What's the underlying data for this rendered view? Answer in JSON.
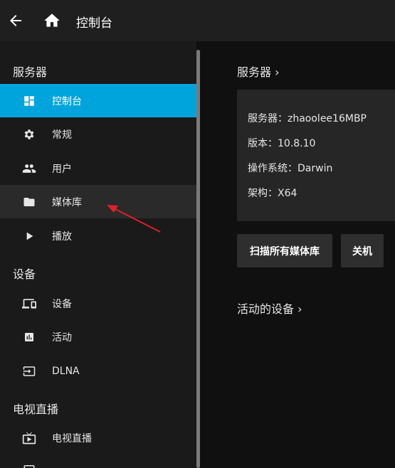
{
  "header": {
    "title": "控制台",
    "back_icon": "arrow-left-icon",
    "home_icon": "home-icon"
  },
  "sidebar": {
    "sections": [
      {
        "title": "服务器"
      },
      {
        "title": "设备"
      },
      {
        "title": "电视直播"
      }
    ],
    "items": [
      {
        "label": "控制台",
        "icon": "dashboard-icon",
        "state": "active"
      },
      {
        "label": "常规",
        "icon": "gear-icon"
      },
      {
        "label": "用户",
        "icon": "users-icon"
      },
      {
        "label": "媒体库",
        "icon": "folder-icon",
        "state": "hovered"
      },
      {
        "label": "播放",
        "icon": "play-icon"
      },
      {
        "label": "设备",
        "icon": "devices-icon"
      },
      {
        "label": "活动",
        "icon": "activity-icon"
      },
      {
        "label": "DLNA",
        "icon": "input-icon"
      },
      {
        "label": "电视直播",
        "icon": "live-tv-icon"
      }
    ]
  },
  "main": {
    "server_heading": "服务器 ›",
    "server_info": {
      "name": "服务器：zhaoolee16MBP",
      "version": "版本：10.8.10",
      "os": "操作系统：Darwin",
      "arch": "架构：X64"
    },
    "buttons": {
      "scan": "扫描所有媒体库",
      "shutdown": "关机"
    },
    "devices_heading": "活动的设备 ›"
  },
  "colors": {
    "accent": "#00a4dc",
    "annotation": "#e0202a"
  }
}
